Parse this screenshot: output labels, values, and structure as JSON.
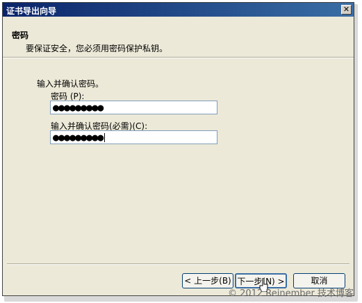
{
  "window": {
    "title": "证书导出向导",
    "close_glyph": "✕"
  },
  "header": {
    "title": "密码",
    "subtitle": "要保证安全，您必须用密码保护私钥。"
  },
  "form": {
    "instruction": "输入并确认密码。",
    "password_label": "密码 (P):",
    "password_value": "●●●●●●●●●",
    "confirm_label": "输入并确认密码(必需)(C):",
    "confirm_value": "●●●●●●●●●"
  },
  "buttons": {
    "back": "< 上一步(B)",
    "next": "下一步(N) >",
    "cancel": "取消"
  },
  "watermark": "© 2012 Reinember 技术博客"
}
